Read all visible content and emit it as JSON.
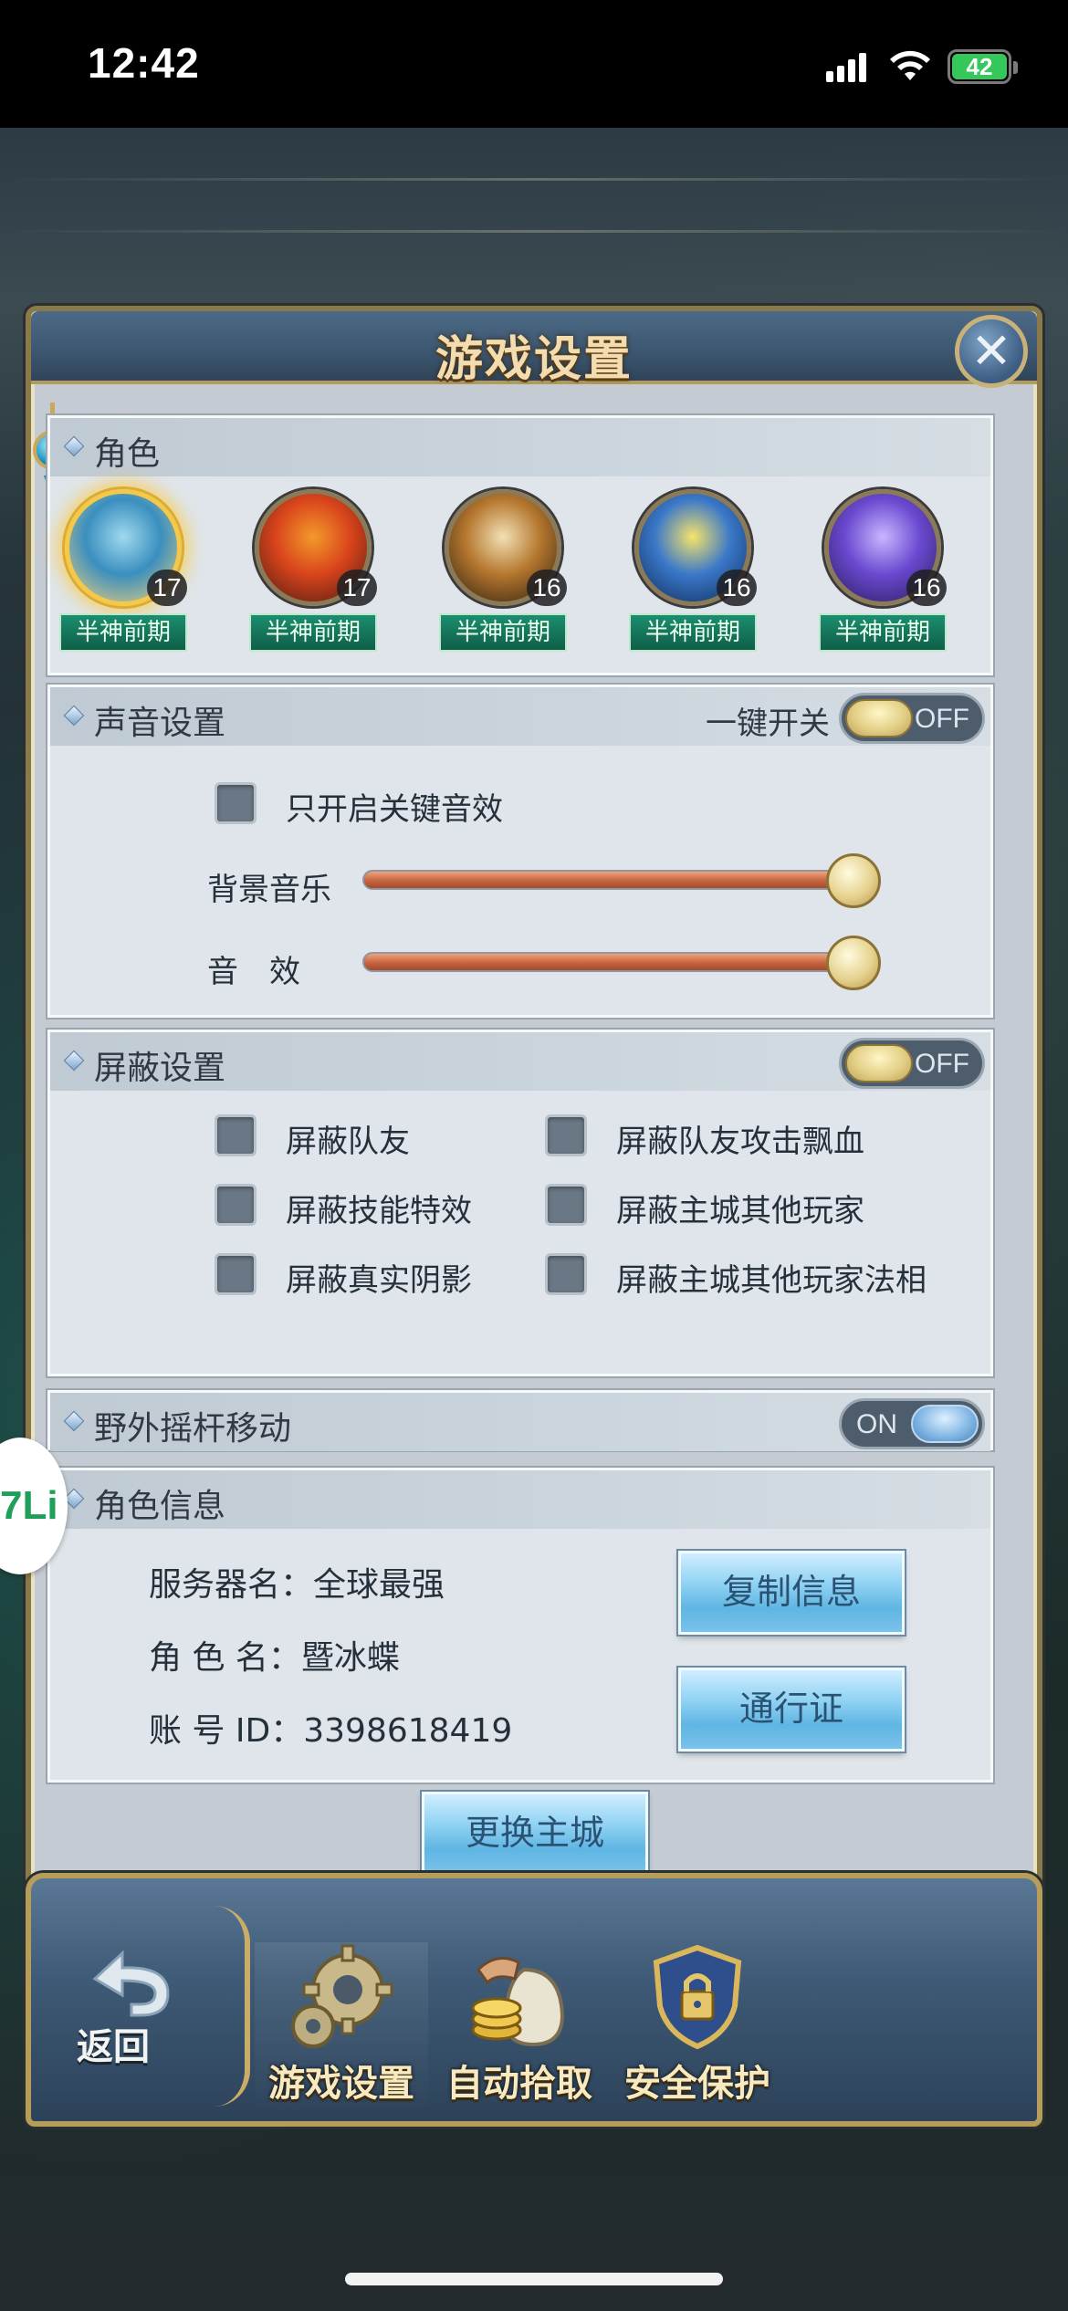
{
  "status": {
    "time": "12:42",
    "battery": "42"
  },
  "panel": {
    "title": "游戏设置",
    "close_label": "✕"
  },
  "role": {
    "title": "角色",
    "heroes": [
      {
        "level": "17",
        "stage": "半神前期",
        "active": true,
        "colors": [
          "#f6d27a",
          "#3a8fbf",
          "#9fd9ee"
        ]
      },
      {
        "level": "17",
        "stage": "半神前期",
        "active": false,
        "colors": [
          "#4a1b12",
          "#d9441c",
          "#f39a2a"
        ]
      },
      {
        "level": "16",
        "stage": "半神前期",
        "active": false,
        "colors": [
          "#2b1c0f",
          "#b5772e",
          "#f2e0b4"
        ]
      },
      {
        "level": "16",
        "stage": "半神前期",
        "active": false,
        "colors": [
          "#0f2b57",
          "#3a78c9",
          "#f6e36a"
        ]
      },
      {
        "level": "16",
        "stage": "半神前期",
        "active": false,
        "colors": [
          "#2a1a5a",
          "#6a4ad0",
          "#c8b6ff"
        ]
      }
    ]
  },
  "sound": {
    "title": "声音设置",
    "master_label": "一键开关",
    "master_toggle": "OFF",
    "key_only_label": "只开启关键音效",
    "bgm_label": "背景音乐",
    "bgm_level": 0.96,
    "sfx_label": "音　效",
    "sfx_level": 0.96
  },
  "block": {
    "title": "屏蔽设置",
    "toggle": "OFF",
    "options": [
      "屏蔽队友",
      "屏蔽队友攻击飘血",
      "屏蔽技能特效",
      "屏蔽主城其他玩家",
      "屏蔽真实阴影",
      "屏蔽主城其他玩家法相"
    ]
  },
  "joystick": {
    "title": "野外摇杆移动",
    "toggle": "ON"
  },
  "info": {
    "title": "角色信息",
    "server": "服务器名：全球最强",
    "name": "角 色 名：暨冰蝶",
    "account": "账 号 ID：3398618419",
    "copy_button": "复制信息",
    "pass_button": "通行证"
  },
  "change_city_button": "更换主城",
  "nav": {
    "back": "返回",
    "items": [
      "游戏设置",
      "自动拾取",
      "安全保护"
    ]
  },
  "side_badge": "7Li"
}
